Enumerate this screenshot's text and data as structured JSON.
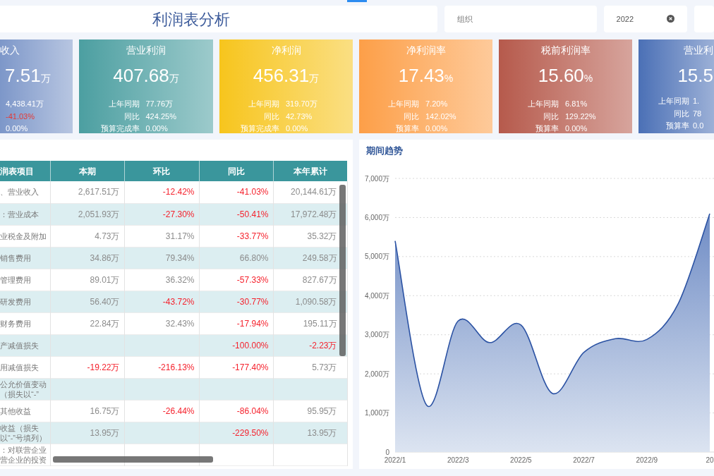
{
  "header": {
    "title": "利润表分析",
    "filters": [
      {
        "placeholder": "组织",
        "clearable": false
      },
      {
        "value": "2022",
        "clearable": true
      },
      {
        "clearable": false
      }
    ]
  },
  "cards": [
    {
      "title": "收入",
      "value": "7.51",
      "unit": "万",
      "color": "#7d97c9",
      "rows": [
        {
          "value": "4,438.41万",
          "negative": false
        },
        {
          "value": "-41.03%",
          "negative": true
        },
        {
          "value": "0.00%",
          "negative": false
        }
      ]
    },
    {
      "title": "营业利润",
      "value": "407.68",
      "unit": "万",
      "color": "#4c9fa1",
      "rows": [
        {
          "label": "上年同期",
          "value": "77.76万",
          "negative": false
        },
        {
          "label": "同比",
          "value": "424.25%",
          "negative": false
        },
        {
          "label": "预算完成率",
          "value": "0.00%",
          "negative": false
        }
      ]
    },
    {
      "title": "净利润",
      "value": "456.31",
      "unit": "万",
      "color": "#f7c51d",
      "rows": [
        {
          "label": "上年同期",
          "value": "319.70万",
          "negative": false
        },
        {
          "label": "同比",
          "value": "42.73%",
          "negative": false
        },
        {
          "label": "预算完成率",
          "value": "0.00%",
          "negative": false
        }
      ]
    },
    {
      "title": "净利润率",
      "value": "17.43",
      "unit": "%",
      "color": "#fd9f48",
      "rows": [
        {
          "label": "上年同期",
          "value": "7.20%",
          "negative": false
        },
        {
          "label": "同比",
          "value": "142.02%",
          "negative": false
        },
        {
          "label": "预算率",
          "value": "0.00%",
          "negative": false
        }
      ]
    },
    {
      "title": "税前利润率",
      "value": "15.60",
      "unit": "%",
      "color": "#b65a4c",
      "rows": [
        {
          "label": "上年同期",
          "value": "6.81%",
          "negative": false
        },
        {
          "label": "同比",
          "value": "129.22%",
          "negative": false
        },
        {
          "label": "预算率",
          "value": "0.00%",
          "negative": false
        }
      ]
    },
    {
      "title": "营业利",
      "value": "15.5",
      "color": "#4b70b6",
      "rows": [
        {
          "label": "上年同期",
          "value": "1.",
          "negative": false
        },
        {
          "label": "同比",
          "value": "78",
          "negative": false
        },
        {
          "label": "预算率",
          "value": "0.0",
          "negative": false
        }
      ]
    }
  ],
  "table": {
    "columns": [
      "润表项目",
      "本期",
      "环比",
      "同比",
      "本年累计"
    ],
    "rows": [
      {
        "cells": [
          {
            "text": "、营业收入",
            "negative": false
          },
          {
            "text": "2,617.51万",
            "negative": false
          },
          {
            "text": "-12.42%",
            "negative": true
          },
          {
            "text": "-41.03%",
            "negative": true
          },
          {
            "text": "20,144.61万",
            "negative": false
          }
        ]
      },
      {
        "cells": [
          {
            "text": "：营业成本",
            "negative": false
          },
          {
            "text": "2,051.93万",
            "negative": false
          },
          {
            "text": "-27.30%",
            "negative": true
          },
          {
            "text": "-50.41%",
            "negative": true
          },
          {
            "text": "17,972.48万",
            "negative": false
          }
        ]
      },
      {
        "cells": [
          {
            "text": "业税金及附加",
            "negative": false
          },
          {
            "text": "4.73万",
            "negative": false
          },
          {
            "text": "31.17%",
            "negative": false
          },
          {
            "text": "-33.77%",
            "negative": true
          },
          {
            "text": "35.32万",
            "negative": false
          }
        ]
      },
      {
        "cells": [
          {
            "text": "销售费用",
            "negative": false
          },
          {
            "text": "34.86万",
            "negative": false
          },
          {
            "text": "79.34%",
            "negative": false
          },
          {
            "text": "66.80%",
            "negative": false
          },
          {
            "text": "249.58万",
            "negative": false
          }
        ]
      },
      {
        "cells": [
          {
            "text": "管理费用",
            "negative": false
          },
          {
            "text": "89.01万",
            "negative": false
          },
          {
            "text": "36.32%",
            "negative": false
          },
          {
            "text": "-57.33%",
            "negative": true
          },
          {
            "text": "827.67万",
            "negative": false
          }
        ]
      },
      {
        "cells": [
          {
            "text": "研发费用",
            "negative": false
          },
          {
            "text": "56.40万",
            "negative": false
          },
          {
            "text": "-43.72%",
            "negative": true
          },
          {
            "text": "-30.77%",
            "negative": true
          },
          {
            "text": "1,090.58万",
            "negative": false
          }
        ]
      },
      {
        "cells": [
          {
            "text": "财务费用",
            "negative": false
          },
          {
            "text": "22.84万",
            "negative": false
          },
          {
            "text": "32.43%",
            "negative": false
          },
          {
            "text": "-17.94%",
            "negative": true
          },
          {
            "text": "195.11万",
            "negative": false
          }
        ]
      },
      {
        "cells": [
          {
            "text": "产减值损失",
            "negative": false
          },
          null,
          null,
          {
            "text": "-100.00%",
            "negative": true
          },
          {
            "text": "-2.23万",
            "negative": true
          }
        ]
      },
      {
        "cells": [
          {
            "text": "用减值损失",
            "negative": false
          },
          {
            "text": "-19.22万",
            "negative": true
          },
          {
            "text": "-216.13%",
            "negative": true
          },
          {
            "text": "-177.40%",
            "negative": true
          },
          {
            "text": "5.73万",
            "negative": false
          }
        ]
      },
      {
        "cells": [
          {
            "text": "公允价值变动（损失以“-”",
            "negative": false
          },
          null,
          null,
          null,
          null
        ]
      },
      {
        "cells": [
          {
            "text": "其他收益",
            "negative": false
          },
          {
            "text": "16.75万",
            "negative": false
          },
          {
            "text": "-26.44%",
            "negative": true
          },
          {
            "text": "-86.04%",
            "negative": true
          },
          {
            "text": "95.95万",
            "negative": false
          }
        ]
      },
      {
        "cells": [
          {
            "text": "收益（损失以“-”号填列）",
            "negative": false
          },
          {
            "text": "13.95万",
            "negative": false
          },
          null,
          {
            "text": "-229.50%",
            "negative": true
          },
          {
            "text": "13.95万",
            "negative": false
          }
        ]
      },
      {
        "cells": [
          {
            "text": "：对联营企业营企业的投资",
            "negative": false
          },
          null,
          null,
          null,
          null
        ]
      }
    ]
  },
  "trend": {
    "chart_data": {
      "type": "area",
      "title": "期间趋势",
      "grid": true,
      "categories": [
        "2022/1",
        null,
        "2022/3",
        null,
        "2022/5",
        null,
        "2022/7",
        null,
        "2022/9",
        null,
        "20"
      ],
      "values": [
        5400,
        1200,
        3350,
        2800,
        3250,
        1500,
        2550,
        2900,
        2880,
        3800,
        6100
      ],
      "ylim": [
        0,
        7000
      ],
      "yticks": [
        {
          "value": 0,
          "label": "0"
        },
        {
          "value": 1000,
          "label": "1,000万"
        },
        {
          "value": 2000,
          "label": "2,000万"
        },
        {
          "value": 3000,
          "label": "3,000万"
        },
        {
          "value": 4000,
          "label": "4,000万"
        },
        {
          "value": 5000,
          "label": "5,000万"
        },
        {
          "value": 6000,
          "label": "6,000万"
        },
        {
          "value": 7000,
          "label": "7,000万"
        }
      ]
    }
  }
}
